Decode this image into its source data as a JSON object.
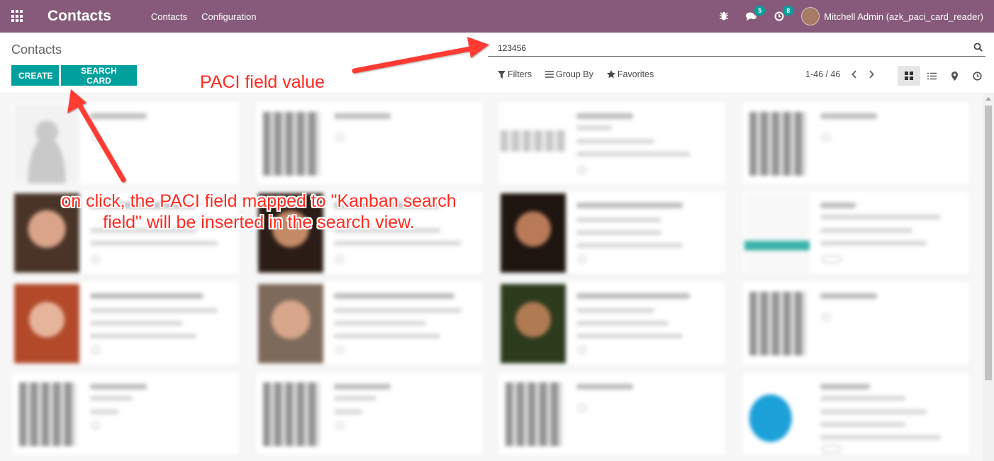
{
  "navbar": {
    "app_title": "Contacts",
    "menus": [
      "Contacts",
      "Configuration"
    ],
    "messages_count": "5",
    "activities_count": "8",
    "user_name": "Mitchell Admin (azk_paci_card_reader)"
  },
  "control_panel": {
    "breadcrumb": "Contacts",
    "search_value": "123456",
    "create_label": "CREATE",
    "search_card_label": "SEARCH CARD",
    "filters_label": "Filters",
    "group_by_label": "Group By",
    "favorites_label": "Favorites",
    "pager_text": "1-46 / 46"
  },
  "annotations": {
    "paci_value": "PACI field value",
    "on_click_line1": "on click, the PACI field mapped to \"Kanban search",
    "on_click_line2": "field\" will be inserted in the search view."
  },
  "colors": {
    "navbar": "#875a7b",
    "primary_button": "#00a09d",
    "annotation": "#ff2a1f"
  }
}
